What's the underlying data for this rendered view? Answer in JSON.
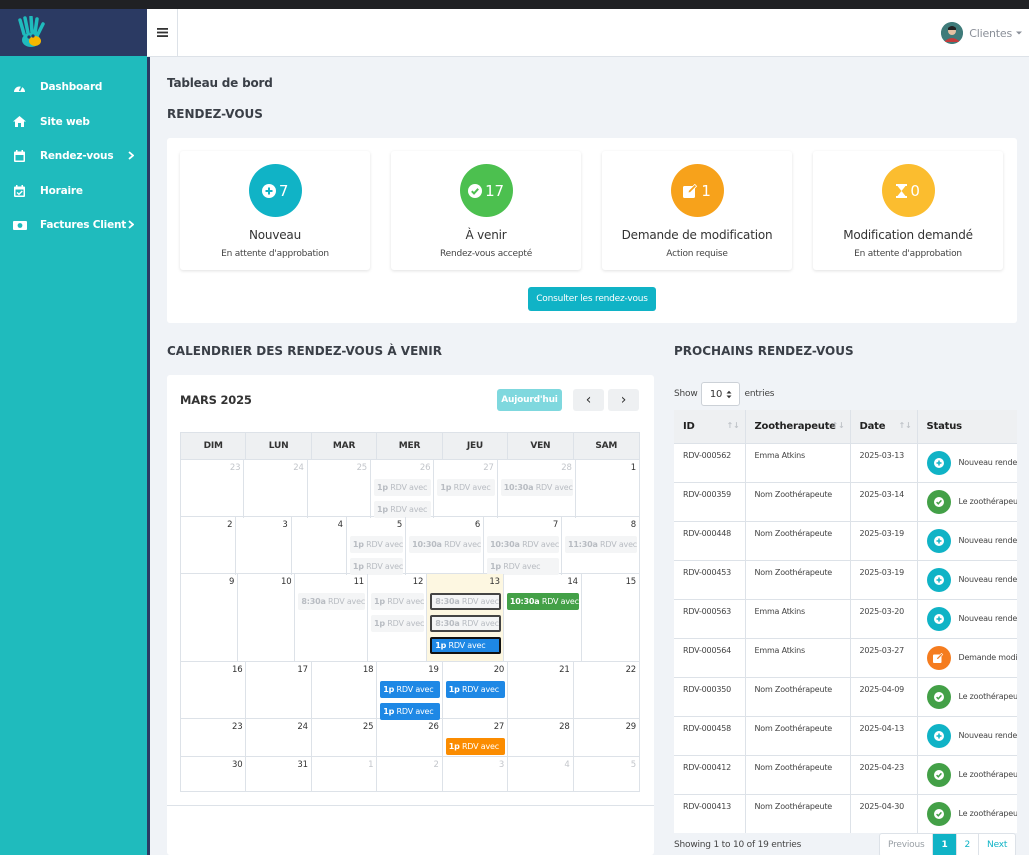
{
  "navbar": {
    "user_label": "Clientes"
  },
  "sidebar": {
    "items": [
      {
        "label": "Dashboard",
        "icon": "dashboard-icon"
      },
      {
        "label": "Site web",
        "icon": "home-icon"
      },
      {
        "label": "Rendez-vous",
        "icon": "calendar-icon",
        "has_submenu": true
      },
      {
        "label": "Horaire",
        "icon": "calendar-check-icon"
      },
      {
        "label": "Factures Client",
        "icon": "money-bill-icon",
        "has_submenu": true
      }
    ]
  },
  "page": {
    "title": "Tableau de bord"
  },
  "rdv_section": {
    "title": "RENDEZ-VOUS",
    "stats": [
      {
        "count": "7",
        "label": "Nouveau",
        "sub": "En attente d'approbation",
        "color": "#10b3c6",
        "icon": "plus-circle-icon"
      },
      {
        "count": "17",
        "label": "À venir",
        "sub": "Rendez-vous accepté",
        "color": "#4cc04f",
        "icon": "check-circle-icon"
      },
      {
        "count": "1",
        "label": "Demande de modification",
        "sub": "Action requise",
        "color": "#f7a21b",
        "icon": "edit-icon"
      },
      {
        "count": "0",
        "label": "Modification demandé",
        "sub": "En attente d'approbation",
        "color": "#fbbd2f",
        "icon": "hourglass-icon"
      }
    ],
    "button": "Consulter les rendez-vous"
  },
  "calendar": {
    "section_title": "CALENDRIER DES RENDEZ-VOUS À VENIR",
    "month": "MARS 2025",
    "today_label": "Aujourd'hui",
    "prev_symbol": "‹",
    "next_symbol": "›",
    "weekdays": [
      "DIM",
      "LUN",
      "MAR",
      "MER",
      "JEU",
      "VEN",
      "SAM"
    ],
    "weeks": [
      {
        "height": 57,
        "days": [
          {
            "d": "23",
            "other": true
          },
          {
            "d": "24",
            "other": true
          },
          {
            "d": "25",
            "other": true
          },
          {
            "d": "26",
            "other": true,
            "events": [
              {
                "t": "1p",
                "x": " RDV avec",
                "k": "past"
              },
              {
                "t": "1p",
                "x": " RDV avec",
                "k": "past"
              }
            ]
          },
          {
            "d": "27",
            "other": true,
            "events": [
              {
                "t": "1p",
                "x": " RDV avec",
                "k": "past"
              }
            ]
          },
          {
            "d": "28",
            "other": true,
            "events": [
              {
                "t": "10:30a",
                "x": " RDV avec",
                "k": "past"
              }
            ]
          },
          {
            "d": "1"
          }
        ]
      },
      {
        "height": 57,
        "days": [
          {
            "d": "2"
          },
          {
            "d": "3"
          },
          {
            "d": "4"
          },
          {
            "d": "5",
            "events": [
              {
                "t": "1p",
                "x": " RDV avec",
                "k": "past"
              },
              {
                "t": "1p",
                "x": " RDV avec",
                "k": "past"
              }
            ]
          },
          {
            "d": "6",
            "events": [
              {
                "t": "10:30a",
                "x": " RDV avec",
                "k": "past"
              }
            ]
          },
          {
            "d": "7",
            "events": [
              {
                "t": "10:30a",
                "x": " RDV avec",
                "k": "past"
              },
              {
                "t": "1p",
                "x": " RDV avec",
                "k": "past"
              }
            ]
          },
          {
            "d": "8",
            "events": [
              {
                "t": "11:30a",
                "x": " RDV avec",
                "k": "past"
              }
            ]
          }
        ]
      },
      {
        "height": 88,
        "days": [
          {
            "d": "9"
          },
          {
            "d": "10"
          },
          {
            "d": "11",
            "events": [
              {
                "t": "8:30a",
                "x": " RDV avec",
                "k": "past"
              }
            ]
          },
          {
            "d": "12",
            "events": [
              {
                "t": "1p",
                "x": " RDV avec",
                "k": "past"
              },
              {
                "t": "1p",
                "x": " RDV avec",
                "k": "past"
              }
            ]
          },
          {
            "d": "13",
            "today": true,
            "events": [
              {
                "t": "8:30a",
                "x": " RDV avec",
                "k": "past outlined"
              },
              {
                "t": "8:30a",
                "x": " RDV avec",
                "k": "past outlined"
              },
              {
                "t": "1p",
                "x": " RDV avec",
                "k": "blue outlined"
              }
            ]
          },
          {
            "d": "14",
            "events": [
              {
                "t": "10:30a",
                "x": " RDV avec",
                "k": "green"
              }
            ]
          },
          {
            "d": "15"
          }
        ]
      },
      {
        "height": 57,
        "days": [
          {
            "d": "16"
          },
          {
            "d": "17"
          },
          {
            "d": "18"
          },
          {
            "d": "19",
            "events": [
              {
                "t": "1p",
                "x": " RDV avec",
                "k": "blue"
              },
              {
                "t": "1p",
                "x": " RDV avec",
                "k": "blue"
              }
            ]
          },
          {
            "d": "20",
            "events": [
              {
                "t": "1p",
                "x": " RDV avec",
                "k": "blue"
              }
            ]
          },
          {
            "d": "21"
          },
          {
            "d": "22"
          }
        ]
      },
      {
        "height": 38,
        "days": [
          {
            "d": "23"
          },
          {
            "d": "24"
          },
          {
            "d": "25"
          },
          {
            "d": "26"
          },
          {
            "d": "27",
            "events": [
              {
                "t": "1p",
                "x": " RDV avec",
                "k": "orange"
              }
            ]
          },
          {
            "d": "28"
          },
          {
            "d": "29"
          }
        ]
      },
      {
        "height": 35,
        "days": [
          {
            "d": "30"
          },
          {
            "d": "31"
          },
          {
            "d": "1",
            "other": true
          },
          {
            "d": "2",
            "other": true
          },
          {
            "d": "3",
            "other": true
          },
          {
            "d": "4",
            "other": true
          },
          {
            "d": "5",
            "other": true
          }
        ]
      }
    ]
  },
  "upcoming": {
    "section_title": "PROCHAINS RENDEZ-VOUS",
    "show_label": "Show",
    "entries_value": "10",
    "entries_label": "entries",
    "columns": [
      "ID",
      "Zootherapeute",
      "Date",
      "Status"
    ],
    "rows": [
      {
        "id": "RDV-000562",
        "zoo": "Emma Atkins",
        "date": "2025-03-13",
        "status": "Nouveau rendez-vous",
        "kind": "new"
      },
      {
        "id": "RDV-000359",
        "zoo": "Nom Zoothérapeute",
        "date": "2025-03-14",
        "status": "Le zoothérapeute",
        "kind": "ok"
      },
      {
        "id": "RDV-000448",
        "zoo": "Nom Zoothérapeute",
        "date": "2025-03-19",
        "status": "Nouveau rendez-vous",
        "kind": "new"
      },
      {
        "id": "RDV-000453",
        "zoo": "Nom Zoothérapeute",
        "date": "2025-03-19",
        "status": "Nouveau rendez-vous",
        "kind": "new"
      },
      {
        "id": "RDV-000563",
        "zoo": "Emma Atkins",
        "date": "2025-03-20",
        "status": "Nouveau rendez-vous",
        "kind": "new"
      },
      {
        "id": "RDV-000564",
        "zoo": "Emma Atkins",
        "date": "2025-03-27",
        "status": "Demande modification",
        "kind": "edit"
      },
      {
        "id": "RDV-000350",
        "zoo": "Nom Zoothérapeute",
        "date": "2025-04-09",
        "status": "Le zoothérapeute",
        "kind": "ok"
      },
      {
        "id": "RDV-000458",
        "zoo": "Nom Zoothérapeute",
        "date": "2025-04-13",
        "status": "Nouveau rendez-vous",
        "kind": "new"
      },
      {
        "id": "RDV-000412",
        "zoo": "Nom Zoothérapeute",
        "date": "2025-04-23",
        "status": "Le zoothérapeute",
        "kind": "ok"
      },
      {
        "id": "RDV-000413",
        "zoo": "Nom Zoothérapeute",
        "date": "2025-04-30",
        "status": "Le zoothérapeute",
        "kind": "ok"
      }
    ],
    "info": "Showing 1 to 10 of 19 entries",
    "pager": {
      "prev": "Previous",
      "pages": [
        "1",
        "2"
      ],
      "next": "Next"
    },
    "status_colors": {
      "new": "#10b3c6",
      "ok": "#43a047",
      "edit": "#f57c1f"
    }
  }
}
